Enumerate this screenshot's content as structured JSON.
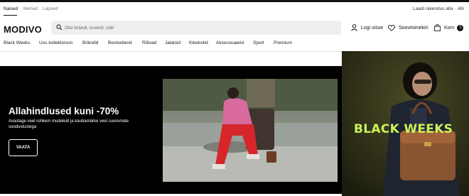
{
  "gender_tabs": [
    {
      "label": "Naised",
      "active": true
    },
    {
      "label": "Mehed",
      "active": false
    },
    {
      "label": "Lapsed",
      "active": false
    }
  ],
  "app_links": {
    "download": "Laadi rakendus alla",
    "help": "Abi"
  },
  "logo": "MODIVO",
  "search": {
    "placeholder": "Otsi brändi, tooteid, stiili"
  },
  "header_actions": {
    "login": "Logi sisse",
    "wishlist": "Soovinimekiri",
    "cart": "Korv",
    "cart_count": "1"
  },
  "categories": [
    "Black Weeks",
    "Uus kollektsioon",
    "Brändid",
    "Bestsellerid",
    "Rõivad",
    "Jalatsid",
    "Kleekotid",
    "Aksessuaarid",
    "Sport",
    "Premium"
  ],
  "hero": {
    "title": "Allahindlused kuni -70%",
    "subtitle": "Avastage veel rohkem mudeleid ja kaubamärke veel suuremate soodustustega",
    "button": "VAATA",
    "banner_text": "BLACK WEEKS"
  },
  "colors": {
    "accent_text": "#c9f25a",
    "hero_bg": "#000000",
    "search_bg": "#efefef"
  },
  "icons": [
    "search-icon",
    "user-icon",
    "heart-icon",
    "bag-icon"
  ]
}
